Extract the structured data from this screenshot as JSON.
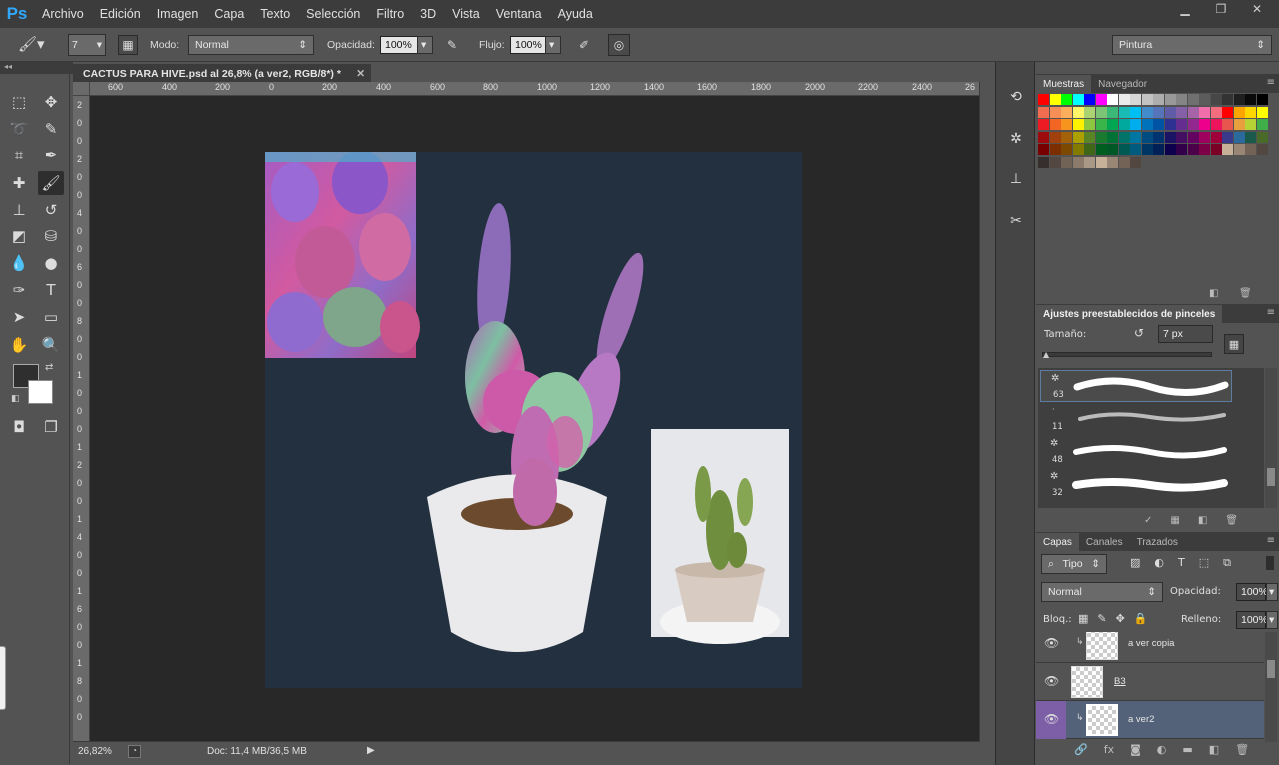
{
  "app": {
    "logo": "Ps"
  },
  "menu": [
    "Archivo",
    "Edición",
    "Imagen",
    "Capa",
    "Texto",
    "Selección",
    "Filtro",
    "3D",
    "Vista",
    "Ventana",
    "Ayuda"
  ],
  "options_bar": {
    "brush_size": "7",
    "mode_label": "Modo:",
    "mode_value": "Normal",
    "opacity_label": "Opacidad:",
    "opacity_value": "100%",
    "flow_label": "Flujo:",
    "flow_value": "100%",
    "workspace": "Pintura"
  },
  "document": {
    "tab_title": "CACTUS PARA HIVE.psd al 26,8% (a ver2, RGB/8*) *",
    "ruler_top": [
      "600",
      "400",
      "200",
      "0",
      "200",
      "400",
      "600",
      "800",
      "1000",
      "1200",
      "1400",
      "1600",
      "1800",
      "2000",
      "2200",
      "2400",
      "26"
    ],
    "ruler_left": [
      "2",
      "0",
      "0",
      "2",
      "0",
      "0",
      "4",
      "0",
      "0",
      "6",
      "0",
      "0",
      "8",
      "0",
      "0",
      "1",
      "0",
      "0",
      "0",
      "1",
      "2",
      "0",
      "0",
      "1",
      "4",
      "0",
      "0",
      "1",
      "6",
      "0",
      "0",
      "1",
      "8",
      "0",
      "0"
    ],
    "canvas_bg": "#22303f"
  },
  "status": {
    "zoom": "26,82%",
    "doc_info": "Doc: 11,4 MB/36,5 MB"
  },
  "panels": {
    "swatches_tabs": [
      "Muestras",
      "Navegador"
    ],
    "brush_presets": {
      "title": "Ajustes preestablecidos de pinceles",
      "size_label": "Tamaño:",
      "size_value": "7 px",
      "brushes": [
        "63",
        "11",
        "48",
        "32"
      ]
    },
    "layers": {
      "tabs": [
        "Capas",
        "Canales",
        "Trazados"
      ],
      "filter_kind": "Tipo",
      "blend_mode": "Normal",
      "opacity_label": "Opacidad:",
      "opacity_value": "100%",
      "lock_label": "Bloq.:",
      "fill_label": "Relleno:",
      "fill_value": "100%",
      "items": [
        {
          "name": "a ver copia",
          "selected": false
        },
        {
          "name": "B3",
          "selected": false
        },
        {
          "name": "a ver2",
          "selected": true
        }
      ]
    }
  },
  "colors": {
    "accent": "#31a8ff",
    "selected_layer": "#536279",
    "eye_selected": "#7d5fa8"
  }
}
